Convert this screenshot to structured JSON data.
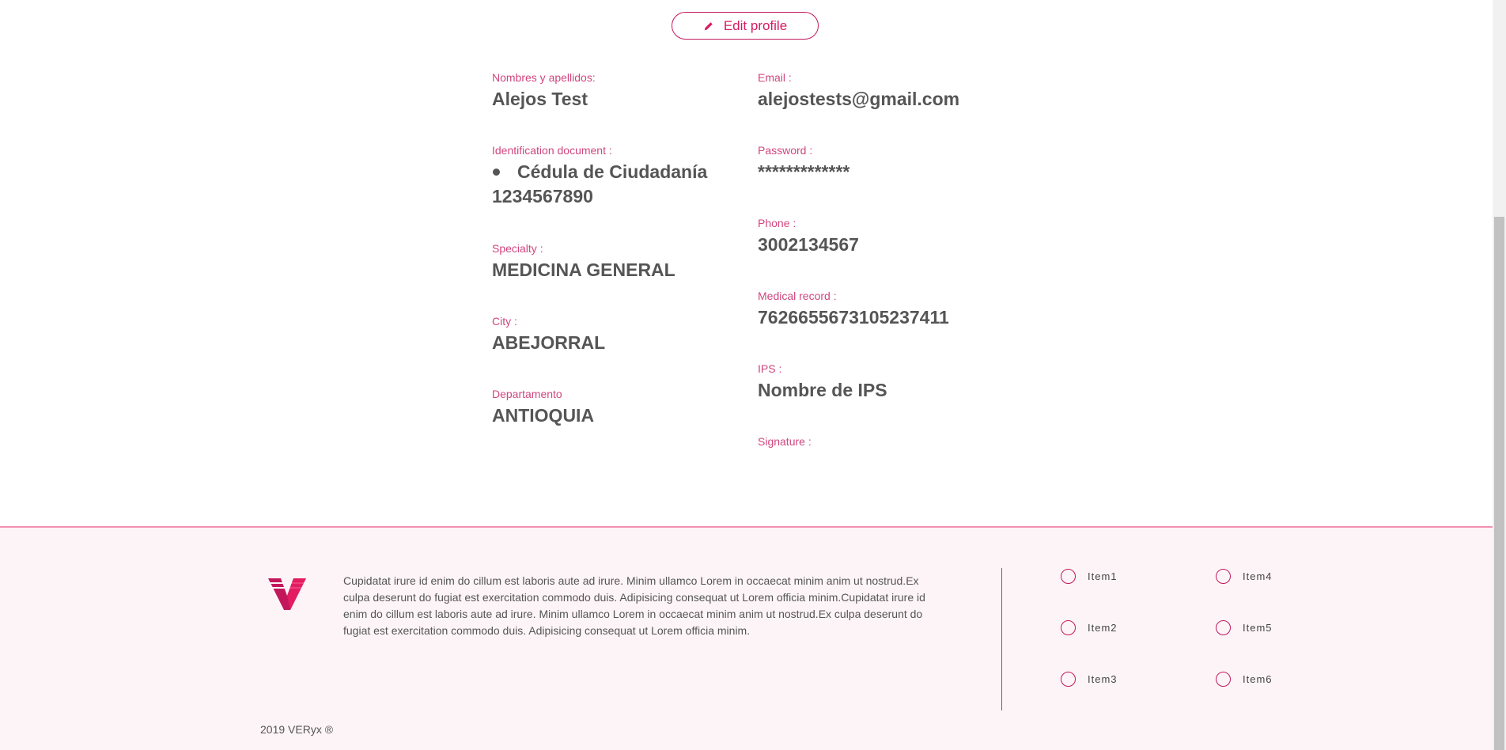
{
  "edit_button": {
    "label": "Edit profile",
    "icon": "pencil-icon"
  },
  "profile": {
    "left": [
      {
        "label": "Nombres y apellidos:",
        "value": "Alejos Test"
      },
      {
        "label": "Identification document :",
        "bullet": "Cédula de Ciudadanía",
        "value": "1234567890"
      },
      {
        "label": "Specialty :",
        "value": "MEDICINA GENERAL"
      },
      {
        "label": "City :",
        "value": "ABEJORRAL"
      },
      {
        "label": "Departamento",
        "value": "ANTIOQUIA"
      }
    ],
    "right": [
      {
        "label": "Email :",
        "value": "alejostests@gmail.com"
      },
      {
        "label": "Password :",
        "value": "*************"
      },
      {
        "label": "Phone :",
        "value": "3002134567"
      },
      {
        "label": "Medical record :",
        "value": "762665567310523741​1"
      },
      {
        "label": "IPS :",
        "value": "Nombre de IPS"
      },
      {
        "label": "Signature :",
        "value": ""
      }
    ]
  },
  "footer": {
    "description": "Cupidatat irure id enim do cillum est laboris aute ad irure. Minim ullamco Lorem in occaecat minim anim ut nostrud.Ex culpa deserunt do fugiat est exercitation commodo duis. Adipisicing consequat ut Lorem officia minim.Cupidatat irure id enim do cillum est laboris aute ad irure. Minim ullamco Lorem in occaecat minim anim ut nostrud.Ex culpa deserunt do fugiat est exercitation commodo duis. Adipisicing consequat ut Lorem officia minim.",
    "items": [
      "Item1",
      "Item2",
      "Item3",
      "Item4",
      "Item5",
      "Item6"
    ],
    "copyright": "2019 VERyx ®"
  },
  "colors": {
    "accent": "#d81b60",
    "label": "#d0467e",
    "footer_bg": "#fdf4f7"
  }
}
